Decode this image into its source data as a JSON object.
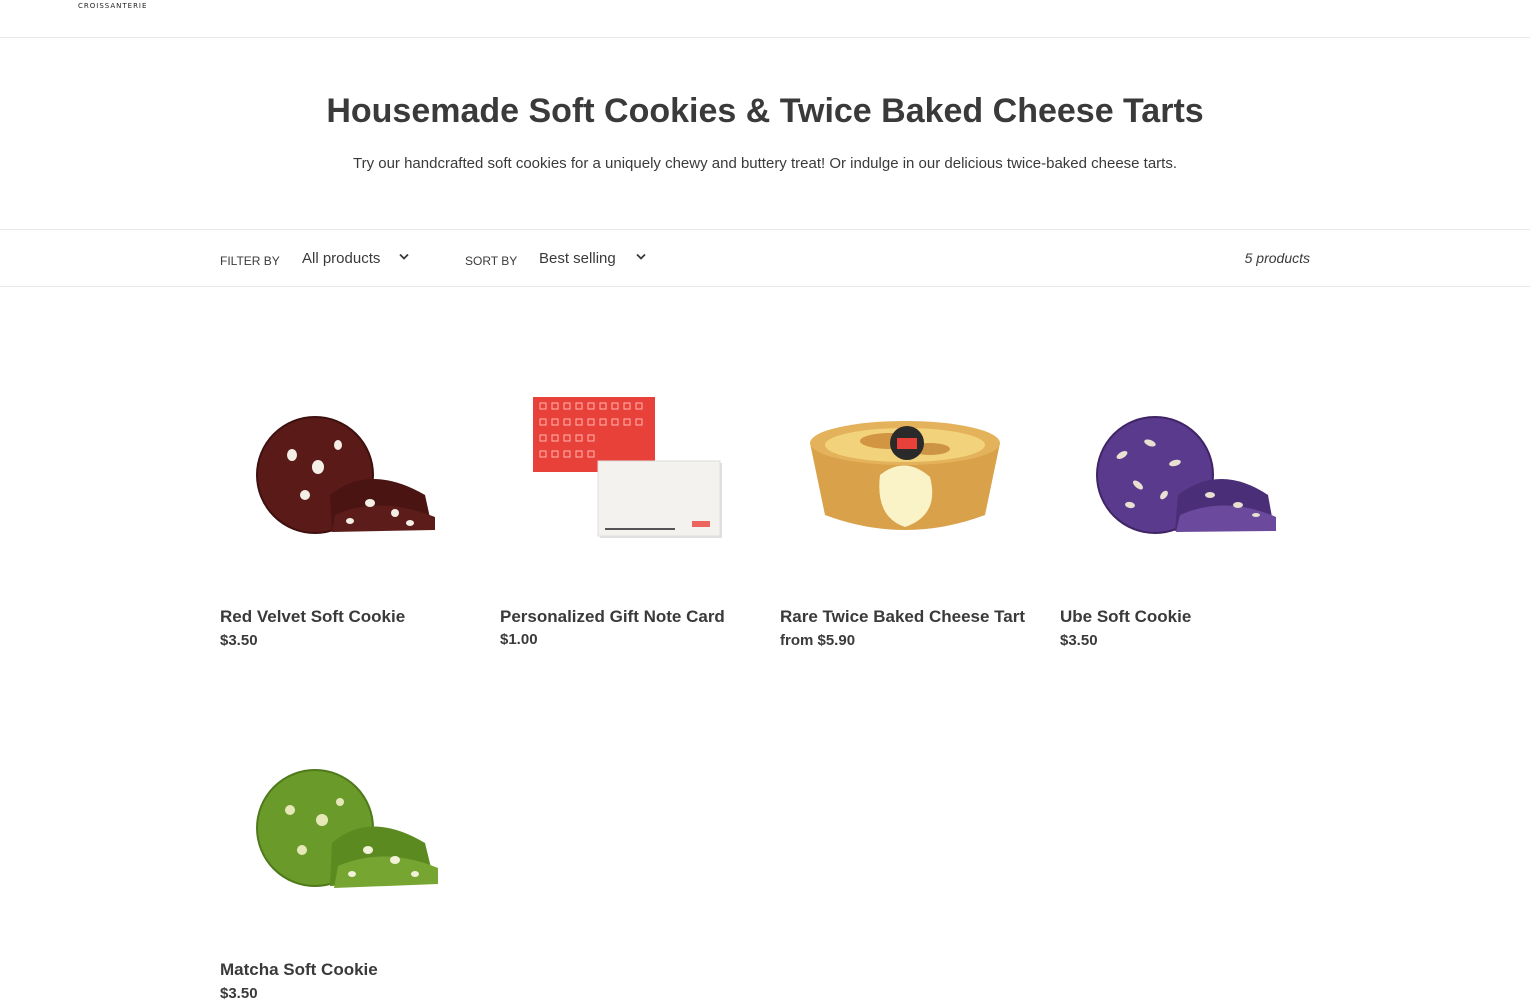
{
  "header": {
    "logo_text": "CROISSANTERIE"
  },
  "collection": {
    "title": "Housemade Soft Cookies & Twice Baked Cheese Tarts",
    "description": "Try our handcrafted soft cookies for a uniquely chewy and buttery treat! Or indulge in our delicious twice-baked cheese tarts."
  },
  "toolbar": {
    "filter_label": "Filter by",
    "filter_value": "All products",
    "sort_label": "Sort by",
    "sort_value": "Best selling",
    "product_count": "5 products"
  },
  "products": [
    {
      "name": "Red Velvet Soft Cookie",
      "price": "$3.50",
      "image": "red-velvet-cookie-image"
    },
    {
      "name": "Personalized Gift Note Card",
      "price": "$1.00",
      "image": "gift-note-card-image"
    },
    {
      "name": "Rare Twice Baked Cheese Tart",
      "price": "from $5.90",
      "image": "cheese-tart-image"
    },
    {
      "name": "Ube Soft Cookie",
      "price": "$3.50",
      "image": "ube-cookie-image"
    },
    {
      "name": "Matcha Soft Cookie",
      "price": "$3.50",
      "image": "matcha-cookie-image"
    }
  ],
  "colors": {
    "text": "#3a3a3a",
    "border": "#e8e8e8",
    "red_velvet": "#5a1a18",
    "card_red": "#e8413a",
    "tart_crust": "#d9a14a",
    "ube": "#5a3a8c",
    "matcha": "#6a9a2a"
  }
}
